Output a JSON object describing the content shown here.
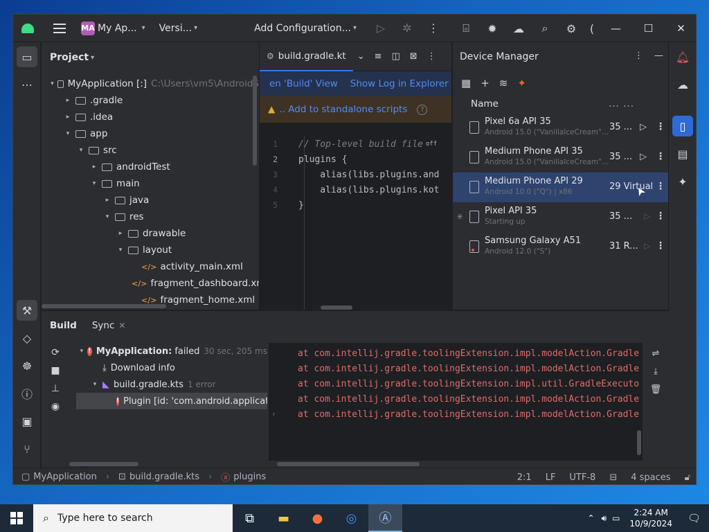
{
  "titlebar": {
    "project_badge": "MA",
    "project_name": "My Ap...",
    "vcs_label": "Versi...",
    "run_config": "Add Configuration...",
    "overflow_glyph": "("
  },
  "project_panel": {
    "title": "Project",
    "tree": [
      {
        "label": "MyApplication [:]",
        "extra": "C:\\Users\\vm5\\AndroidS",
        "indent": 0,
        "arrow": "down",
        "type": "module"
      },
      {
        "label": ".gradle",
        "indent": 1,
        "arrow": "right",
        "type": "folder"
      },
      {
        "label": ".idea",
        "indent": 1,
        "arrow": "right",
        "type": "folder"
      },
      {
        "label": "app",
        "indent": 1,
        "arrow": "down",
        "type": "folder"
      },
      {
        "label": "src",
        "indent": 2,
        "arrow": "down",
        "type": "folder"
      },
      {
        "label": "androidTest",
        "indent": 3,
        "arrow": "right",
        "type": "folder"
      },
      {
        "label": "main",
        "indent": 3,
        "arrow": "down",
        "type": "folder"
      },
      {
        "label": "java",
        "indent": 4,
        "arrow": "right",
        "type": "folder"
      },
      {
        "label": "res",
        "indent": 4,
        "arrow": "down",
        "type": "folder"
      },
      {
        "label": "drawable",
        "indent": 5,
        "arrow": "right",
        "type": "folder"
      },
      {
        "label": "layout",
        "indent": 5,
        "arrow": "down",
        "type": "folder"
      },
      {
        "label": "activity_main.xml",
        "indent": 6,
        "arrow": "",
        "type": "xml"
      },
      {
        "label": "fragment_dashboard.xm",
        "indent": 6,
        "arrow": "",
        "type": "xml"
      },
      {
        "label": "fragment_home.xml",
        "indent": 6,
        "arrow": "",
        "type": "xml"
      }
    ]
  },
  "editor": {
    "tab_label": "build.gradle.kt",
    "banner_links": [
      "en 'Build' View",
      "Show Log in Explorer"
    ],
    "warning_text": ".. Add to standalone scripts",
    "warning_glyph": "▲",
    "off_badge": "off",
    "lines": [
      {
        "num": "1",
        "text": "// Top-level build file",
        "kind": "comment"
      },
      {
        "num": "2",
        "text": "plugins {",
        "kind": "plain",
        "current": true
      },
      {
        "num": "3",
        "text": "    alias(libs.plugins.and",
        "kind": "plain"
      },
      {
        "num": "4",
        "text": "    alias(libs.plugins.kot",
        "kind": "plain"
      },
      {
        "num": "5",
        "text": "}",
        "kind": "plain"
      }
    ]
  },
  "device_manager": {
    "title": "Device Manager",
    "column_name": "Name",
    "column_dots": "... ...",
    "devices": [
      {
        "name": "Pixel 6a API 35",
        "sub": "Android 15.0 (\"VanillaIceCream\"...",
        "api": "35 ...",
        "play": true,
        "running": false
      },
      {
        "name": "Medium Phone API 35",
        "sub": "Android 15.0 (\"VanillaIceCream\"...",
        "api": "35 ...",
        "play": true,
        "running": false
      },
      {
        "name": "Medium Phone API 29",
        "sub": "Android 10.0 (\"Q\") | x86",
        "api": "29 Virtual",
        "play": false,
        "selected": true
      },
      {
        "name": "Pixel API 35",
        "sub": "Starting up",
        "api": "35 ...",
        "play": true,
        "starting": true
      },
      {
        "name": "Samsung Galaxy A51",
        "sub": "Android 12.0 (\"S\")",
        "api": "31 R...",
        "play": true,
        "physical": true
      }
    ]
  },
  "build": {
    "tab_build": "Build",
    "tab_sync": "Sync",
    "tree": [
      {
        "label": "MyApplication:",
        "status": "failed",
        "time": "30 sec, 205 ms",
        "indent": 0,
        "icon": "error"
      },
      {
        "label": "Download info",
        "indent": 1,
        "icon": "download"
      },
      {
        "label": "build.gradle.kts",
        "extra": "1 error",
        "indent": 1,
        "icon": "kts",
        "arrow": "down"
      },
      {
        "label": "Plugin [id: 'com.android.applicat",
        "indent": 2,
        "icon": "error",
        "selected": true
      }
    ],
    "console_lines": [
      "at com.intellij.gradle.toolingExtension.impl.modelAction.Gradle",
      "at com.intellij.gradle.toolingExtension.impl.modelAction.Gradle",
      "at com.intellij.gradle.toolingExtension.impl.util.GradleExecuto",
      "at com.intellij.gradle.toolingExtension.impl.modelAction.Gradle",
      "at com.intellij.gradle.toolingExtension.impl.modelAction.Gradle"
    ]
  },
  "statusbar": {
    "crumbs": [
      "MyApplication",
      "build.gradle.kts",
      "plugins"
    ],
    "position": "2:1",
    "line_sep": "LF",
    "encoding": "UTF-8",
    "indent": "4 spaces"
  },
  "taskbar": {
    "search_placeholder": "Type here to search",
    "time": "2:24 AM",
    "date": "10/9/2024"
  },
  "colors": {
    "accent": "#3574f0",
    "error": "#db5c5c",
    "selection": "#2e436e"
  }
}
